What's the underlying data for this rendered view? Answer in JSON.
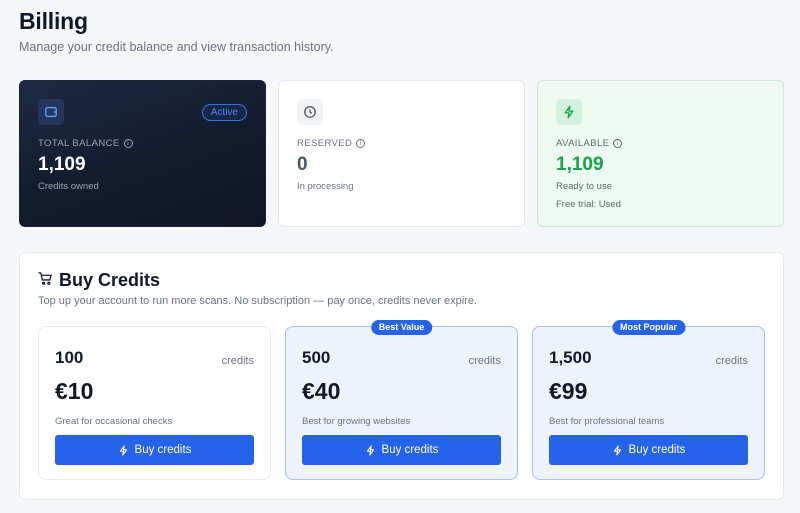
{
  "header": {
    "title": "Billing",
    "subtitle": "Manage your credit balance and view transaction history."
  },
  "stats": {
    "balance": {
      "label": "TOTAL BALANCE",
      "value": "1,109",
      "caption": "Credits owned",
      "badge": "Active",
      "icon": "wallet-icon"
    },
    "reserved": {
      "label": "RESERVED",
      "value": "0",
      "caption": "In processing",
      "icon": "clock-icon"
    },
    "available": {
      "label": "AVAILABLE",
      "value": "1,109",
      "caption": "Ready to use",
      "extra": "Free trial: Used",
      "icon": "lightning-icon"
    }
  },
  "buy": {
    "title": "Buy Credits",
    "subtitle": "Top up your account to run more scans. No subscription — pay once, credits never expire.",
    "icon": "cart-icon",
    "packs": [
      {
        "amount": "100",
        "unit": "credits",
        "price": "€10",
        "description": "Great for occasional checks",
        "button": "Buy credits",
        "ribbon": ""
      },
      {
        "amount": "500",
        "unit": "credits",
        "price": "€40",
        "description": "Best for growing websites",
        "button": "Buy credits",
        "ribbon": "Best Value"
      },
      {
        "amount": "1,500",
        "unit": "credits",
        "price": "€99",
        "description": "Best for professional teams",
        "button": "Buy credits",
        "ribbon": "Most Popular"
      }
    ]
  },
  "colors": {
    "accent": "#2563eb",
    "success": "#16a34a",
    "dark_card": "#121a2b"
  }
}
